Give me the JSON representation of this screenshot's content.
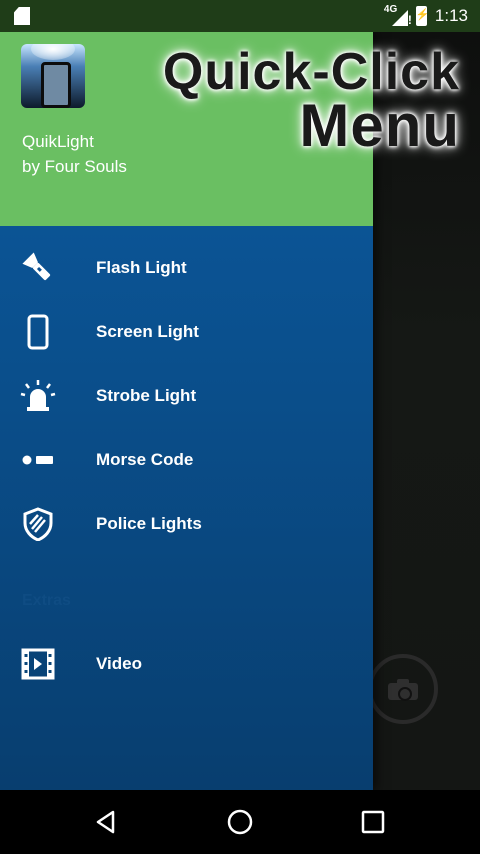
{
  "status_bar": {
    "network": "4G",
    "time": "1:13"
  },
  "promo": {
    "line1": "Quick-Click",
    "line2": "Menu"
  },
  "drawer": {
    "header": {
      "app_name": "QuikLight",
      "developer": "by Four Souls"
    },
    "items": [
      {
        "label": "Flash Light",
        "icon": "flashlight-icon"
      },
      {
        "label": "Screen Light",
        "icon": "phone-icon"
      },
      {
        "label": "Strobe Light",
        "icon": "strobe-icon"
      },
      {
        "label": "Morse Code",
        "icon": "morse-icon"
      },
      {
        "label": "Police Lights",
        "icon": "shield-icon"
      }
    ],
    "extras_section": {
      "label": "Extras",
      "items": [
        {
          "label": "Video",
          "icon": "video-icon"
        }
      ]
    }
  },
  "nav_bar": {
    "back": "back-icon",
    "home": "home-icon",
    "recents": "recents-icon"
  },
  "colors": {
    "header_green": "#6abf62",
    "drawer_blue": "#0d5aa0",
    "status_bar": "#1f3d18"
  }
}
